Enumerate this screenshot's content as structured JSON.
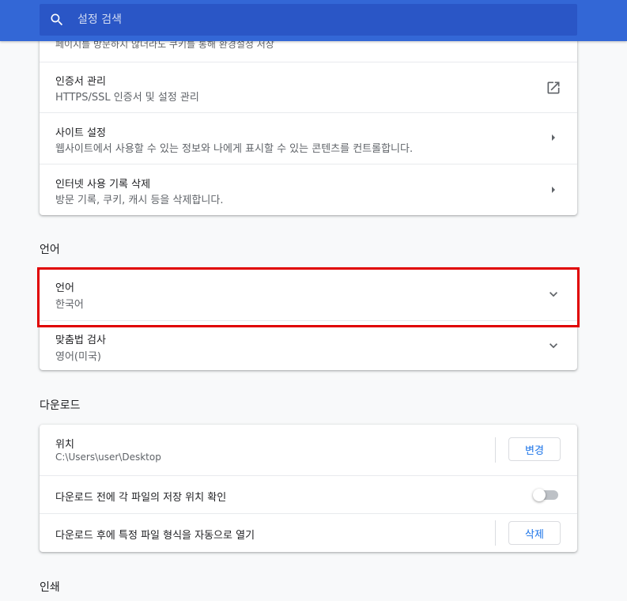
{
  "search": {
    "placeholder": "설정 검색"
  },
  "privacy": {
    "partial_text": "페이지를 방문하지 않더라도 쿠키를 통해 환경설정 저장",
    "rows": [
      {
        "title": "인증서 관리",
        "subtitle": "HTTPS/SSL 인증서 및 설정 관리",
        "trailing_icon": "open-in-new-icon"
      },
      {
        "title": "사이트 설정",
        "subtitle": "웹사이트에서 사용할 수 있는 정보와 나에게 표시할 수 있는 콘텐츠를 컨트롤합니다.",
        "trailing_icon": "arrow-right-icon"
      },
      {
        "title": "인터넷 사용 기록 삭제",
        "subtitle": "방문 기록, 쿠키, 캐시 등을 삭제합니다.",
        "trailing_icon": "arrow-right-icon"
      }
    ]
  },
  "language": {
    "section_title": "언어",
    "rows": [
      {
        "title": "언어",
        "subtitle": "한국어",
        "trailing_icon": "chevron-down-icon"
      },
      {
        "title": "맞춤법 검사",
        "subtitle": "영어(미국)",
        "trailing_icon": "chevron-down-icon"
      }
    ]
  },
  "downloads": {
    "section_title": "다운로드",
    "location_title": "위치",
    "location_value": "C:\\Users\\user\\Desktop",
    "change_button": "변경",
    "ask_label": "다운로드 전에 각 파일의 저장 위치 확인",
    "ask_enabled": false,
    "auto_open_label": "다운로드 후에 특정 파일 형식을 자동으로 열기",
    "clear_button": "삭제"
  },
  "printing": {
    "section_title": "인쇄"
  },
  "colors": {
    "header": "#3367d6",
    "search_bg": "#2a56c6",
    "link_blue": "#1a73e8",
    "highlight": "#e00000"
  }
}
